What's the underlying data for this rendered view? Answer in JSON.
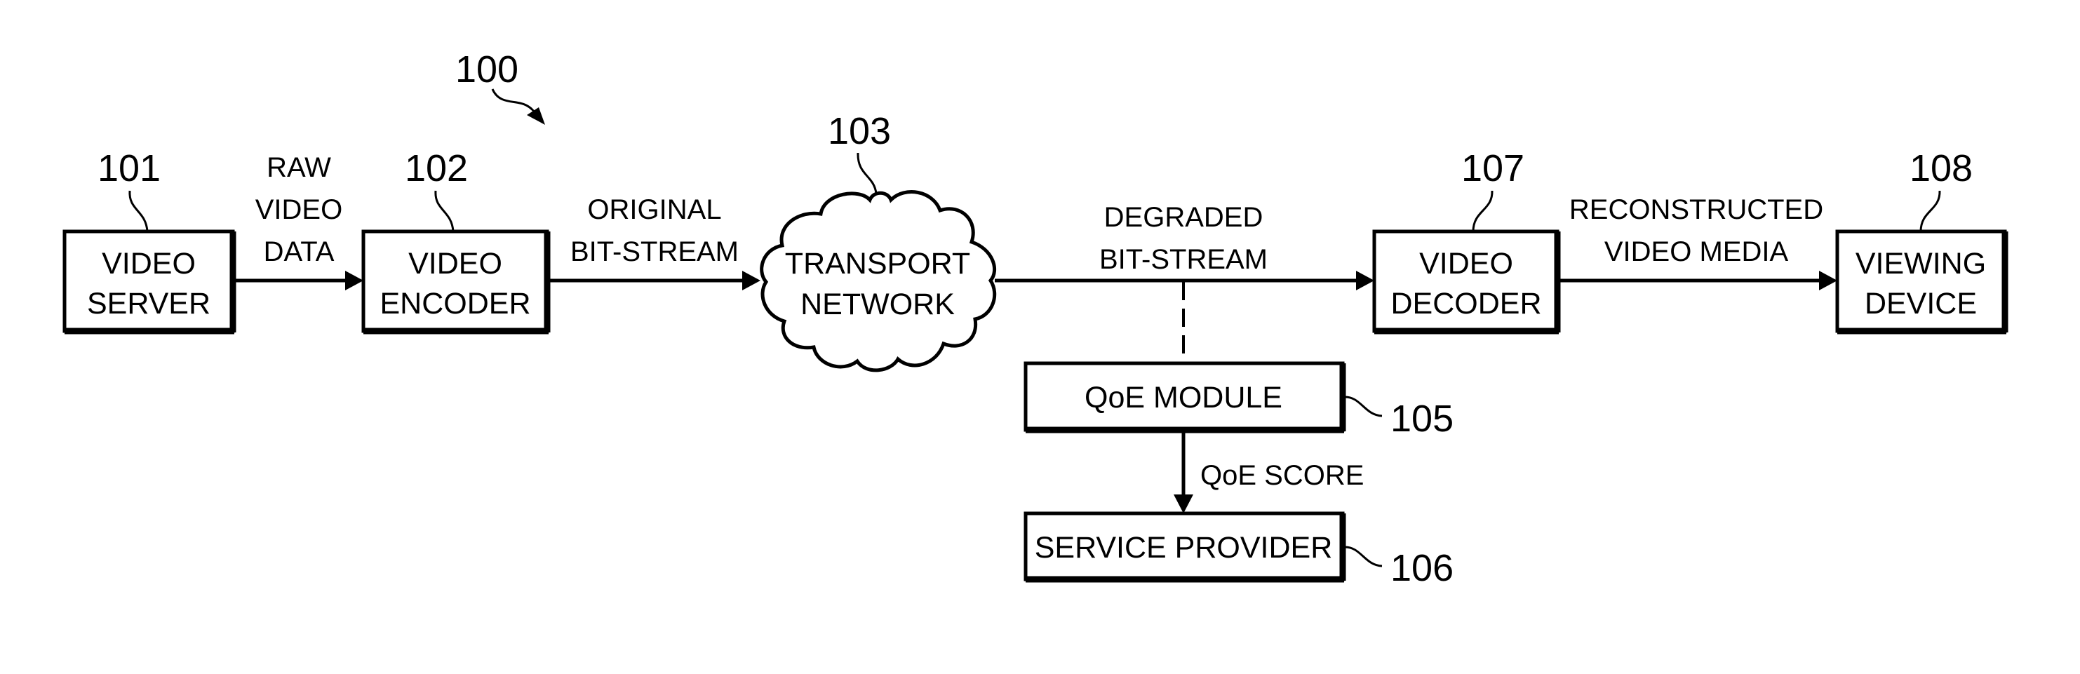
{
  "figure_ref": "100",
  "nodes": {
    "video_server": {
      "ref": "101",
      "lines": [
        "VIDEO",
        "SERVER"
      ]
    },
    "video_encoder": {
      "ref": "102",
      "lines": [
        "VIDEO",
        "ENCODER"
      ]
    },
    "transport_network": {
      "ref": "103",
      "lines": [
        "TRANSPORT",
        "NETWORK"
      ]
    },
    "qoe_module": {
      "ref": "105",
      "lines": [
        "QoE MODULE"
      ]
    },
    "service_provider": {
      "ref": "106",
      "lines": [
        "SERVICE PROVIDER"
      ]
    },
    "video_decoder": {
      "ref": "107",
      "lines": [
        "VIDEO",
        "DECODER"
      ]
    },
    "viewing_device": {
      "ref": "108",
      "lines": [
        "VIEWING",
        "DEVICE"
      ]
    }
  },
  "edges": {
    "raw_video_data": {
      "lines": [
        "RAW",
        "VIDEO",
        "DATA"
      ]
    },
    "original_bitstream": {
      "lines": [
        "ORIGINAL",
        "BIT-STREAM"
      ]
    },
    "degraded_bitstream": {
      "lines": [
        "DEGRADED",
        "BIT-STREAM"
      ]
    },
    "reconstructed_video_media": {
      "lines": [
        "RECONSTRUCTED",
        "VIDEO MEDIA"
      ]
    },
    "qoe_score": {
      "lines": [
        "QoE SCORE"
      ]
    }
  }
}
